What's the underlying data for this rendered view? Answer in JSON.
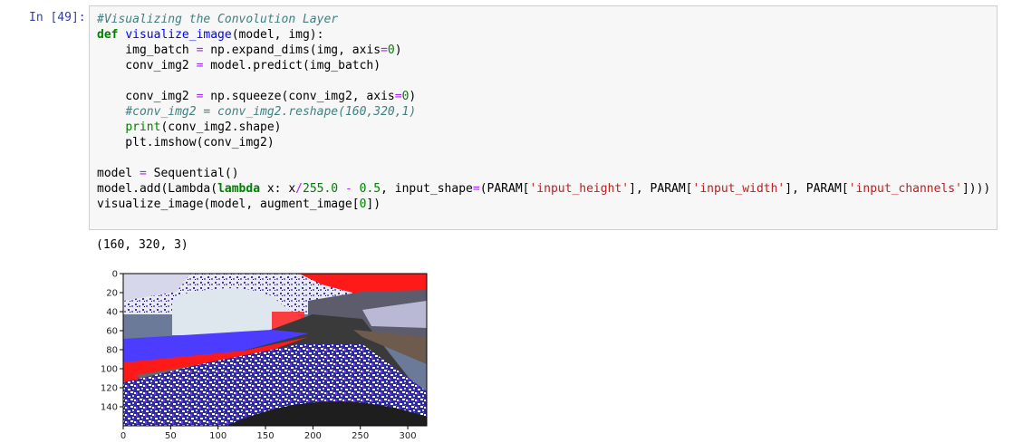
{
  "cell": {
    "prompt": "In [49]:",
    "code_lines": [
      [
        {
          "t": "#Visualizing the Convolution Layer",
          "c": "cm"
        }
      ],
      [
        {
          "t": "def",
          "c": "kw"
        },
        {
          "t": " "
        },
        {
          "t": "visualize_image",
          "c": "fn"
        },
        {
          "t": "(model, img):"
        }
      ],
      [
        {
          "t": "    img_batch "
        },
        {
          "t": "=",
          "c": "op"
        },
        {
          "t": " np.expand_dims(img, axis"
        },
        {
          "t": "=",
          "c": "op"
        },
        {
          "t": "0",
          "c": "num"
        },
        {
          "t": ")"
        }
      ],
      [
        {
          "t": "    conv_img2 "
        },
        {
          "t": "=",
          "c": "op"
        },
        {
          "t": " model.predict(img_batch)"
        }
      ],
      [
        {
          "t": ""
        }
      ],
      [
        {
          "t": "    conv_img2 "
        },
        {
          "t": "=",
          "c": "op"
        },
        {
          "t": " np.squeeze(conv_img2, axis"
        },
        {
          "t": "=",
          "c": "op"
        },
        {
          "t": "0",
          "c": "num"
        },
        {
          "t": ")"
        }
      ],
      [
        {
          "t": "    "
        },
        {
          "t": "#conv_img2 = conv_img2.reshape(160,320,1)",
          "c": "cm"
        }
      ],
      [
        {
          "t": "    "
        },
        {
          "t": "print",
          "c": "bi"
        },
        {
          "t": "(conv_img2.shape)"
        }
      ],
      [
        {
          "t": "    plt.imshow(conv_img2)"
        }
      ],
      [
        {
          "t": ""
        }
      ],
      [
        {
          "t": "model "
        },
        {
          "t": "=",
          "c": "op"
        },
        {
          "t": " Sequential()"
        }
      ],
      [
        {
          "t": "model.add(Lambda("
        },
        {
          "t": "lambda",
          "c": "kw"
        },
        {
          "t": " x: x"
        },
        {
          "t": "/",
          "c": "op"
        },
        {
          "t": "255.0",
          "c": "num"
        },
        {
          "t": " "
        },
        {
          "t": "-",
          "c": "op"
        },
        {
          "t": " "
        },
        {
          "t": "0.5",
          "c": "num"
        },
        {
          "t": ", input_shape"
        },
        {
          "t": "=",
          "c": "op"
        },
        {
          "t": "(PARAM["
        },
        {
          "t": "'input_height'",
          "c": "str"
        },
        {
          "t": "], PARAM["
        },
        {
          "t": "'input_width'",
          "c": "str"
        },
        {
          "t": "], PARAM["
        },
        {
          "t": "'input_channels'",
          "c": "str"
        },
        {
          "t": "])))"
        }
      ],
      [
        {
          "t": "visualize_image(model, augment_image["
        },
        {
          "t": "0",
          "c": "num"
        },
        {
          "t": "])"
        }
      ]
    ]
  },
  "output": {
    "text": "(160, 320, 3)"
  },
  "chart_data": {
    "type": "image",
    "xlim": [
      0,
      320
    ],
    "ylim": [
      160,
      0
    ],
    "x_ticks": [
      0,
      50,
      100,
      150,
      200,
      250,
      300
    ],
    "y_ticks": [
      0,
      20,
      40,
      60,
      80,
      100,
      120,
      140
    ],
    "image_description_colors": {
      "sky": "#ff1a1a",
      "road": "#3a3a3a",
      "left_band": "#4b3cff",
      "snow": "#dfe7ee",
      "ground_noise_a": "#2a2aa0",
      "ground_noise_b": "#ffffff",
      "hood": "#1e1e1e"
    }
  }
}
